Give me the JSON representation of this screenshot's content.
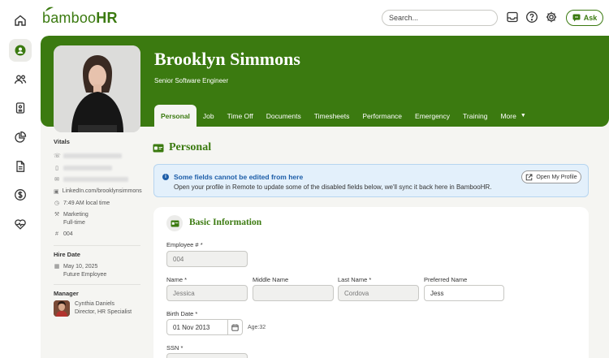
{
  "app": {
    "logo_main": "bamboo",
    "logo_suffix": "HR"
  },
  "header": {
    "search_placeholder": "Search...",
    "ask_label": "Ask"
  },
  "nav": [
    "home-icon",
    "person-icon",
    "people-icon",
    "id-badge-icon",
    "pie-chart-icon",
    "document-icon",
    "dollar-icon",
    "heart-pulse-icon"
  ],
  "employee": {
    "name": "Brooklyn Simmons",
    "job_title": "Senior Software Engineer"
  },
  "tabs": [
    {
      "label": "Personal",
      "active": true
    },
    {
      "label": "Job"
    },
    {
      "label": "Time Off"
    },
    {
      "label": "Documents"
    },
    {
      "label": "Timesheets"
    },
    {
      "label": "Performance"
    },
    {
      "label": "Emergency"
    },
    {
      "label": "Training"
    },
    {
      "label": "More"
    }
  ],
  "vitals": {
    "heading": "Vitals",
    "linkedin": "LinkedIn.com/brooklynsimmons",
    "local_time": "7:49 AM local time",
    "department": "Marketing",
    "employment_type": "Full-time",
    "employee_number": "004"
  },
  "hire": {
    "heading": "Hire Date",
    "date": "May 10, 2025",
    "status": "Future Employee"
  },
  "manager": {
    "heading": "Manager",
    "name": "Cynthia Daniels",
    "title": "Director, HR Specialist"
  },
  "section": {
    "title": "Personal"
  },
  "notice": {
    "title": "Some fields cannot be edited from here",
    "body": "Open your profile in Remote to update some of the disabled fields below, we'll sync it back here in BambooHR.",
    "button": "Open My Profile"
  },
  "basic_info": {
    "title": "Basic Information",
    "employee_number_label": "Employee # *",
    "employee_number_value": "004",
    "first_name_label": "Name *",
    "first_name_value": "Jessica",
    "middle_name_label": "Middle Name",
    "middle_name_value": "",
    "last_name_label": "Last Name *",
    "last_name_value": "Cordova",
    "preferred_name_label": "Preferred Name",
    "preferred_name_value": "Jess",
    "birth_date_label": "Birth Date *",
    "birth_date_value": "01 Nov 2013",
    "age_text": "Age:32",
    "ssn_label": "SSN *"
  },
  "colors": {
    "brand": "#3b7a10",
    "info": "#1c5da8"
  }
}
